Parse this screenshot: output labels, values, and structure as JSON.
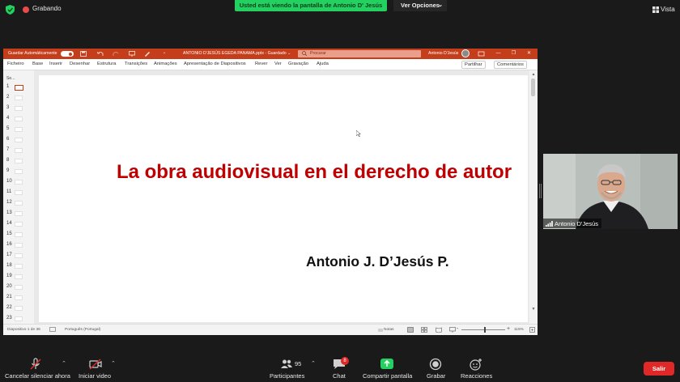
{
  "zoom": {
    "recording_label": "Grabando",
    "share_banner": "Usted está viendo la pantalla de Antonio D' Jesús",
    "view_options": "Ver Opciones",
    "view_label": "Vista"
  },
  "ppt": {
    "autosave_label": "Guardar Automáticamente",
    "doc_title": "ANTONIO D'JESÚS EGEDA PANAMA.pptx - Guardado ⌄",
    "search_placeholder": "Procurar",
    "user_name": "Antonio D'Jesús",
    "menu": [
      "Ficheiro",
      "Base",
      "Inserir",
      "Desenhar",
      "Estrutura",
      "Transições",
      "Animações",
      "Apresentação de Diapositivos",
      "Rever",
      "Ver",
      "Gravação",
      "Ajuda"
    ],
    "share_label": "Partilhar",
    "comments_label": "Comentários",
    "thumb_header": "Se...",
    "thumbnail_numbers": [
      "1",
      "2",
      "3",
      "4",
      "5",
      "6",
      "7",
      "8",
      "9",
      "10",
      "11",
      "12",
      "13",
      "14",
      "15",
      "16",
      "17",
      "18",
      "19",
      "20",
      "21",
      "22",
      "23"
    ],
    "slide": {
      "title": "La obra audiovisual en el derecho de autor",
      "author": "Antonio J. D’Jesús P."
    },
    "status": {
      "slide_counter": "Diapositivo 1 de 36",
      "language": "Português (Portugal)",
      "notes": "Notas",
      "zoom": "115%"
    }
  },
  "video": {
    "participant_name": "Antonio D'Jesús"
  },
  "toolbar": {
    "unmute": "Cancelar silenciar ahora",
    "start_video": "Iniciar video",
    "participants": "Participantes",
    "participants_count": "95",
    "chat": "Chat",
    "chat_badge": "8",
    "share_screen": "Compartir pantalla",
    "record": "Grabar",
    "reactions": "Reacciones",
    "leave": "Salir"
  },
  "colors": {
    "ppt_accent": "#c43e1c",
    "slide_title": "#c00000",
    "share_banner": "#23d160",
    "leave": "#e02828"
  }
}
